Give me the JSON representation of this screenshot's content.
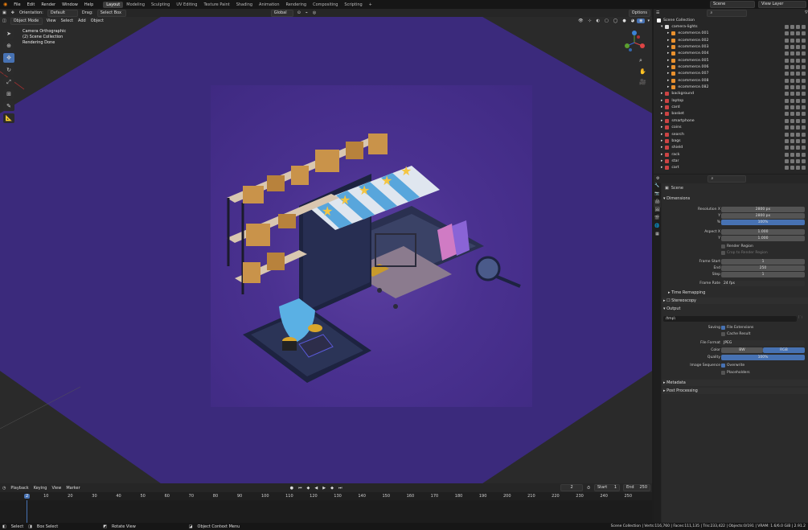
{
  "topbar": {
    "menus": [
      "File",
      "Edit",
      "Render",
      "Window",
      "Help"
    ],
    "workspaces": [
      "Layout",
      "Modeling",
      "Sculpting",
      "UV Editing",
      "Texture Paint",
      "Shading",
      "Animation",
      "Rendering",
      "Compositing",
      "Scripting"
    ],
    "active_workspace": "Layout",
    "scene_label": "Scene",
    "view_layer_label": "View Layer"
  },
  "tool_header": {
    "orientation_label": "Orientation:",
    "orientation_value": "Default",
    "drag_label": "Drag:",
    "drag_value": "Select Box",
    "transform_value": "Global",
    "options_label": "Options"
  },
  "viewport_header": {
    "mode": "Object Mode",
    "menus": [
      "View",
      "Select",
      "Add",
      "Object"
    ]
  },
  "viewport_info": {
    "line1": "Camera Orthographic",
    "line2": "(2) Scene Collection",
    "line3": "Rendering Done"
  },
  "timeline": {
    "menus": [
      "Playback",
      "Keying",
      "View",
      "Marker"
    ],
    "current_frame": "2",
    "start_label": "Start",
    "start_value": "1",
    "end_label": "End",
    "end_value": "250",
    "ticks": [
      "2",
      "10",
      "20",
      "30",
      "40",
      "50",
      "60",
      "70",
      "80",
      "90",
      "100",
      "110",
      "120",
      "130",
      "140",
      "150",
      "160",
      "170",
      "180",
      "190",
      "200",
      "210",
      "220",
      "230",
      "240",
      "250"
    ]
  },
  "statusbar": {
    "select": "Select",
    "box_select": "Box Select",
    "rotate_view": "Rotate View",
    "context_menu": "Object Context Menu",
    "stats": "Scene Collection | Verts:116,760 | Faces:111,135 | Tris:233,422 | Objects:0/191 | VRAM: 1.6/6.0 GiB | 2.91.2"
  },
  "outliner": {
    "root": "Scene Collection",
    "items": [
      {
        "name": "camera-lights",
        "level": 1
      },
      {
        "name": "ecommerce.001",
        "level": 2
      },
      {
        "name": "ecommerce.002",
        "level": 2
      },
      {
        "name": "ecommerce.003",
        "level": 2
      },
      {
        "name": "ecommerce.004",
        "level": 2
      },
      {
        "name": "ecommerce.005",
        "level": 2
      },
      {
        "name": "ecommerce.006",
        "level": 2
      },
      {
        "name": "ecommerce.007",
        "level": 2
      },
      {
        "name": "ecommerce.008",
        "level": 2
      },
      {
        "name": "ecommerce.082",
        "level": 2
      },
      {
        "name": "background",
        "level": 1
      },
      {
        "name": "laptop",
        "level": 1
      },
      {
        "name": "card",
        "level": 1
      },
      {
        "name": "basket",
        "level": 1
      },
      {
        "name": "smartphone",
        "level": 1
      },
      {
        "name": "coins",
        "level": 1
      },
      {
        "name": "search",
        "level": 1
      },
      {
        "name": "bags",
        "level": 1
      },
      {
        "name": "shield",
        "level": 1
      },
      {
        "name": "rack",
        "level": 1
      },
      {
        "name": "star",
        "level": 1
      },
      {
        "name": "cart",
        "level": 1
      }
    ]
  },
  "properties": {
    "context": "Scene",
    "dimensions": {
      "title": "Dimensions",
      "res_x_label": "Resolution X",
      "res_x": "2800 px",
      "res_y_label": "Y",
      "res_y": "2800 px",
      "pct_label": "%",
      "pct": "100%",
      "aspect_x_label": "Aspect X",
      "aspect_x": "1.000",
      "aspect_y_label": "Y",
      "aspect_y": "1.000",
      "render_region": "Render Region",
      "crop": "Crop to Render Region",
      "frame_start_label": "Frame Start",
      "frame_start": "1",
      "end_label": "End",
      "end": "250",
      "step_label": "Step",
      "step": "1",
      "frame_rate_label": "Frame Rate",
      "frame_rate": "24 fps",
      "time_remapping": "Time Remapping"
    },
    "stereoscopy": "Stereoscopy",
    "output": {
      "title": "Output",
      "path": "/tmp\\",
      "saving_label": "Saving",
      "file_extensions": "File Extensions",
      "cache_result": "Cache Result",
      "file_format_label": "File Format",
      "file_format": "JPEG",
      "color_label": "Color",
      "color_bw": "BW",
      "color_rgb": "RGB",
      "quality_label": "Quality",
      "quality": "100%",
      "image_sequence_label": "Image Sequence",
      "overwrite": "Overwrite",
      "placeholders": "Placeholders"
    },
    "metadata": "Metadata",
    "post_processing": "Post Processing"
  },
  "colors": {
    "accent": "#4772b3",
    "viewport_bg": "#3a2d7a",
    "panel_bg": "#262626"
  }
}
